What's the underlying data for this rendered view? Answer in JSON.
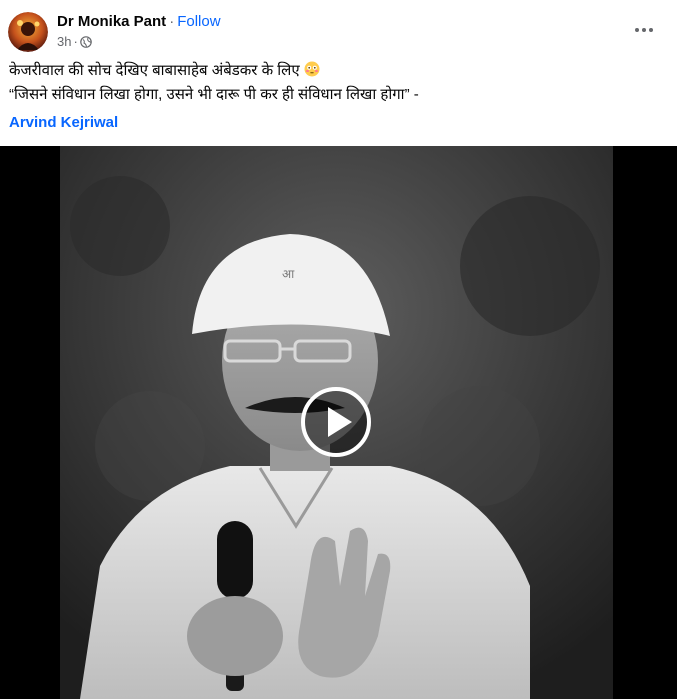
{
  "post": {
    "author_name": "Dr Monika Pant",
    "separator": "·",
    "follow_label": "Follow",
    "timestamp": "3h",
    "meta_separator": "·",
    "privacy_icon": "globe-icon",
    "more_icon": "more-horizontal-icon",
    "text_line_1": "केजरीवाल की सोच देखिए बाबासाहेब अंबेडकर के लिए",
    "text_line_1_emoji": "flushed-face-emoji",
    "text_line_2": "“जिसने संविधान लिखा होगा, उसने भी दारू पी कर ही संविधान लिखा होगा” -",
    "mention": "Arvind Kejriwal",
    "video": {
      "play_icon": "play-icon",
      "style": "grayscale"
    }
  },
  "colors": {
    "link": "#0866ff",
    "secondary_text": "#65676b",
    "primary_text": "#050505",
    "video_bg": "#000000"
  }
}
